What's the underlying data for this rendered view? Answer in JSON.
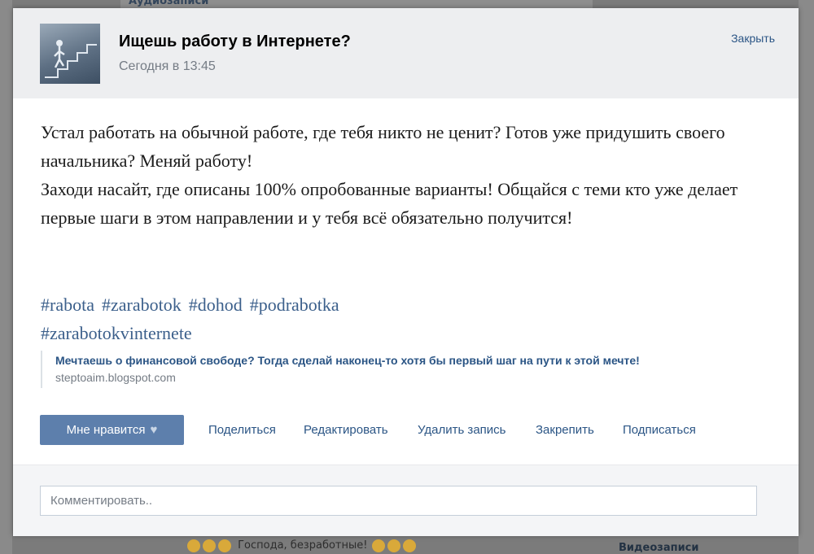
{
  "background": {
    "top_section": "Аудиозаписи",
    "bottom_post": "Господа, безработные!",
    "right_section": "Видеозаписи"
  },
  "post": {
    "title": "Ищешь работу в Интернете?",
    "time": "Сегодня в 13:45",
    "close_label": "Закрыть",
    "paragraphs": [
      "Устал работать на обычной работе, где тебя никто не ценит? Готов уже придушить своего начальника? Меняй работу!",
      "Заходи насайт, где описаны 100% опробованные варианты! Общайся с теми кто уже делает первые шаги в этом направлении и у тебя всё обязательно получится!"
    ],
    "hashtags": [
      "#rabota",
      "#zarabotok",
      "#dohod",
      "#podrabotka",
      "#zarabotokvinternete"
    ],
    "link": {
      "title": "Мечтаешь о финансовой свободе? Тогда сделай наконец-то хотя бы первый шаг на пути к этой мечте!",
      "url": "steptoaim.blogspot.com"
    },
    "actions": {
      "like": "Мне нравится",
      "share": "Поделиться",
      "edit": "Редактировать",
      "delete": "Удалить запись",
      "pin": "Закрепить",
      "subscribe": "Подписаться"
    },
    "comment_placeholder": "Комментировать.."
  },
  "colors": {
    "link": "#2b5585",
    "like_button": "#5d7fac",
    "header_bg": "#edeef0"
  },
  "icons": {
    "like": "heart-icon"
  }
}
